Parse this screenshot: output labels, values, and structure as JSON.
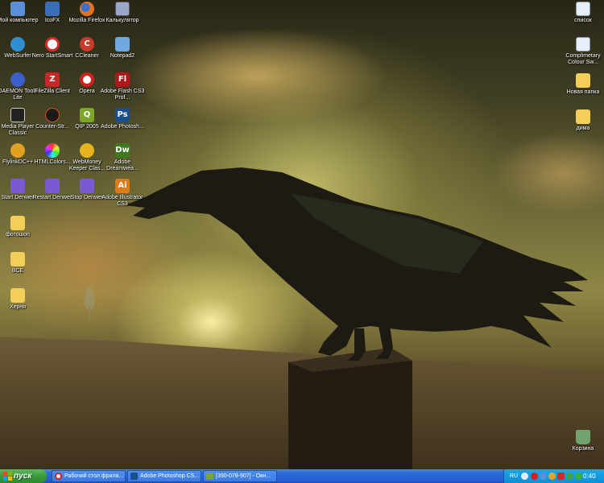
{
  "desktop_icons": {
    "my_computer": {
      "label": "Мой компьютер",
      "icon": "computer-icon",
      "color": "#5b8fd8"
    },
    "icofx": {
      "label": "IcoFX",
      "icon": "icofx-icon",
      "color": "#3a6fb8"
    },
    "firefox": {
      "label": "Mozilla Firefox",
      "icon": "firefox-icon",
      "color": "#e8731c"
    },
    "calculator": {
      "label": "Калькулятор",
      "icon": "calculator-icon",
      "color": "#9aa7c8"
    },
    "websurfer": {
      "label": "WebSurfer",
      "icon": "globe-icon",
      "color": "#2f8fd0"
    },
    "nero": {
      "label": "Nero StartSmart",
      "icon": "nero-icon",
      "color": "#d92b2b"
    },
    "ccleaner": {
      "label": "CCleaner",
      "icon": "ccleaner-icon",
      "color": "#c83a2a"
    },
    "notepad2": {
      "label": "Notepad2",
      "icon": "notepad-icon",
      "color": "#6fa8e0"
    },
    "daemon": {
      "label": "DAEMON Tools Lite",
      "icon": "daemon-tools-icon",
      "color": "#3c5ec8"
    },
    "filezilla": {
      "label": "FileZilla Client",
      "icon": "filezilla-icon",
      "color": "#c62828"
    },
    "opera": {
      "label": "Opera",
      "icon": "opera-icon",
      "color": "#d41f1f"
    },
    "flash": {
      "label": "Adobe Flash CS3 Prof...",
      "icon": "flash-icon",
      "color": "#b0171b",
      "glyph": "Fl"
    },
    "mpc": {
      "label": "Media Player Classic",
      "icon": "media-player-icon",
      "color": "#222"
    },
    "counter_strike": {
      "label": "Counter-Str...",
      "icon": "counter-strike-icon",
      "color": "#1a1a1a"
    },
    "qip": {
      "label": "QIP 2005",
      "icon": "qip-icon",
      "color": "#7da52a"
    },
    "photoshop": {
      "label": "Adobe Photosh...",
      "icon": "photoshop-icon",
      "color": "#1a4f8e",
      "glyph": "Ps"
    },
    "flylink": {
      "label": "FlylinkDC++",
      "icon": "flylink-icon",
      "color": "#e0a020"
    },
    "htmlcolors": {
      "label": "HTMLColors...",
      "icon": "htmlcolors-icon",
      "color": "#8a3fb8"
    },
    "webmoney": {
      "label": "WebMoney Keeper Clas...",
      "icon": "webmoney-icon",
      "color": "#e7b21c"
    },
    "dreamweaver": {
      "label": "Adobe Dreamwea...",
      "icon": "dreamweaver-icon",
      "color": "#3d7a1e",
      "glyph": "Dw"
    },
    "start_denwer": {
      "label": "Start Denwer",
      "icon": "denwer-start-icon",
      "color": "#7a5ad0"
    },
    "restart_denwer": {
      "label": "Restart Denwer",
      "icon": "denwer-restart-icon",
      "color": "#7a5ad0"
    },
    "stop_denwer": {
      "label": "Stop Denwer",
      "icon": "denwer-stop-icon",
      "color": "#7a5ad0"
    },
    "illustrator": {
      "label": "Adobe Illustrator CS3",
      "icon": "illustrator-icon",
      "color": "#e07a16",
      "glyph": "Ai"
    },
    "photoshop_folder": {
      "label": "фотошоп",
      "icon": "folder-icon",
      "color": "#f3cf5a"
    },
    "vse_folder": {
      "label": "ВСЕ",
      "icon": "folder-icon",
      "color": "#f3cf5a"
    },
    "herna_folder": {
      "label": "Херня",
      "icon": "folder-icon",
      "color": "#f3cf5a"
    },
    "spisok": {
      "label": "список",
      "icon": "text-file-icon",
      "color": "#e8eef7"
    },
    "colour_swatches": {
      "label": "Complimetary Colour Sw...",
      "icon": "swatch-file-icon",
      "color": "#e8eef7"
    },
    "new_folder": {
      "label": "Новая папка",
      "icon": "folder-icon",
      "color": "#f3cf5a"
    },
    "dima_folder": {
      "label": "дима",
      "icon": "folder-icon",
      "color": "#f3cf5a"
    },
    "recycle_bin": {
      "label": "Корзина",
      "icon": "recycle-bin-icon",
      "color": "#6fa36f"
    }
  },
  "taskbar": {
    "start_label": "пуск",
    "tasks": [
      {
        "label": "Рабочий стол фрила...",
        "icon": "opera-icon",
        "color": "#d41f1f"
      },
      {
        "label": "Adobe Photoshop CS...",
        "icon": "photoshop-icon",
        "color": "#1a4f8e"
      },
      {
        "label": "[390-078-907] - Окн...",
        "icon": "qip-icon",
        "color": "#7da52a"
      }
    ],
    "language": "RU",
    "clock": "0:40"
  },
  "colors": {
    "taskbar_blue": "#235fd2",
    "start_green": "#3a9a3a",
    "tray_blue": "#0f8fd6"
  }
}
